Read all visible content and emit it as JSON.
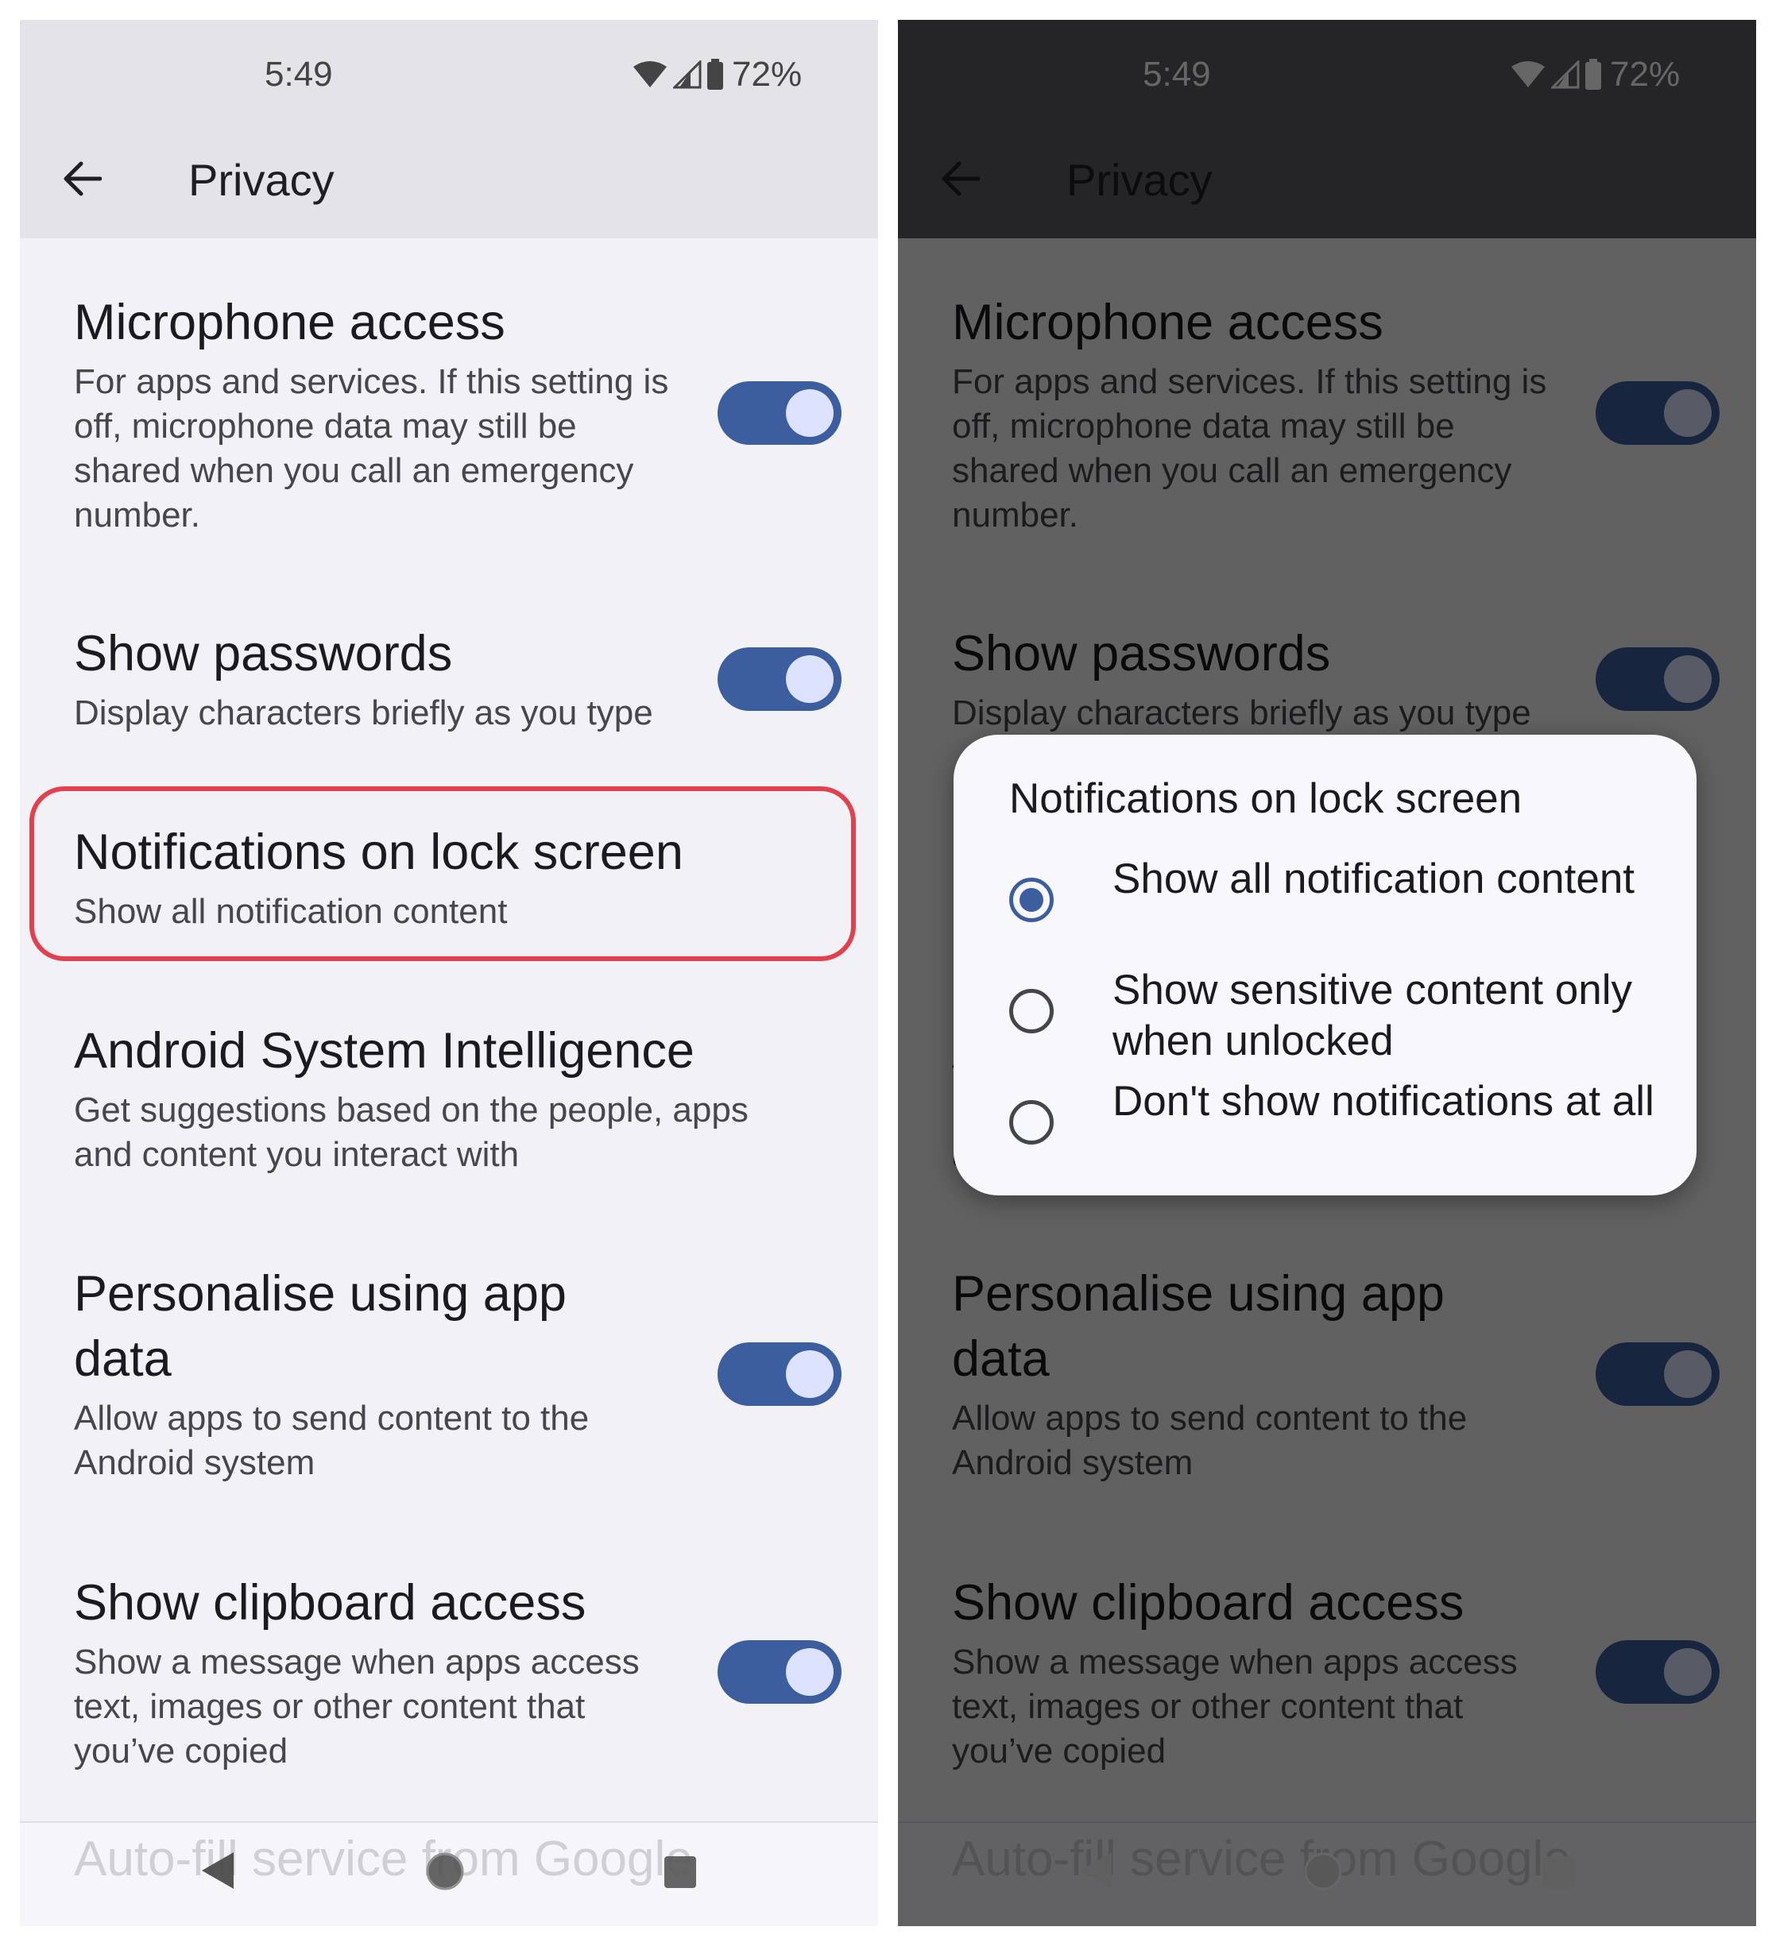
{
  "status": {
    "time": "5:49",
    "battery": "72%"
  },
  "appbar": {
    "title": "Privacy"
  },
  "settings": {
    "microphone": {
      "title": "Microphone access",
      "summary": "For apps and services. If this setting is off, microphone data may still be shared when you call an emergency number.",
      "enabled": true
    },
    "passwords": {
      "title": "Show passwords",
      "summary": "Display characters briefly as you type",
      "enabled": true
    },
    "lockscreen": {
      "title": "Notifications on lock screen",
      "summary": "Show all notification content"
    },
    "asi": {
      "title": "Android System Intelligence",
      "summary": "Get suggestions based on the people, apps and content you interact with"
    },
    "personalise": {
      "title": "Personalise using app data",
      "summary": "Allow apps to send content to the Android system",
      "enabled": true
    },
    "clipboard": {
      "title": "Show clipboard access",
      "summary": "Show a message when apps access text, images or other content that you’ve copied",
      "enabled": true
    }
  },
  "footer": {
    "faded_item": "Auto-fill service from Google"
  },
  "dialog": {
    "title": "Notifications on lock screen",
    "options": [
      {
        "label": "Show all notification content",
        "selected": true
      },
      {
        "label": "Show sensitive content only when unlocked",
        "selected": false
      },
      {
        "label": "Don't show notifications at all",
        "selected": false
      }
    ]
  },
  "colors": {
    "accent": "#3c5e9e",
    "highlight": "#e3404d",
    "background": "#f2f2f6"
  },
  "icons": {
    "back": "back-arrow-icon",
    "wifi": "wifi-icon",
    "signal": "signal-icon",
    "battery": "battery-icon"
  }
}
